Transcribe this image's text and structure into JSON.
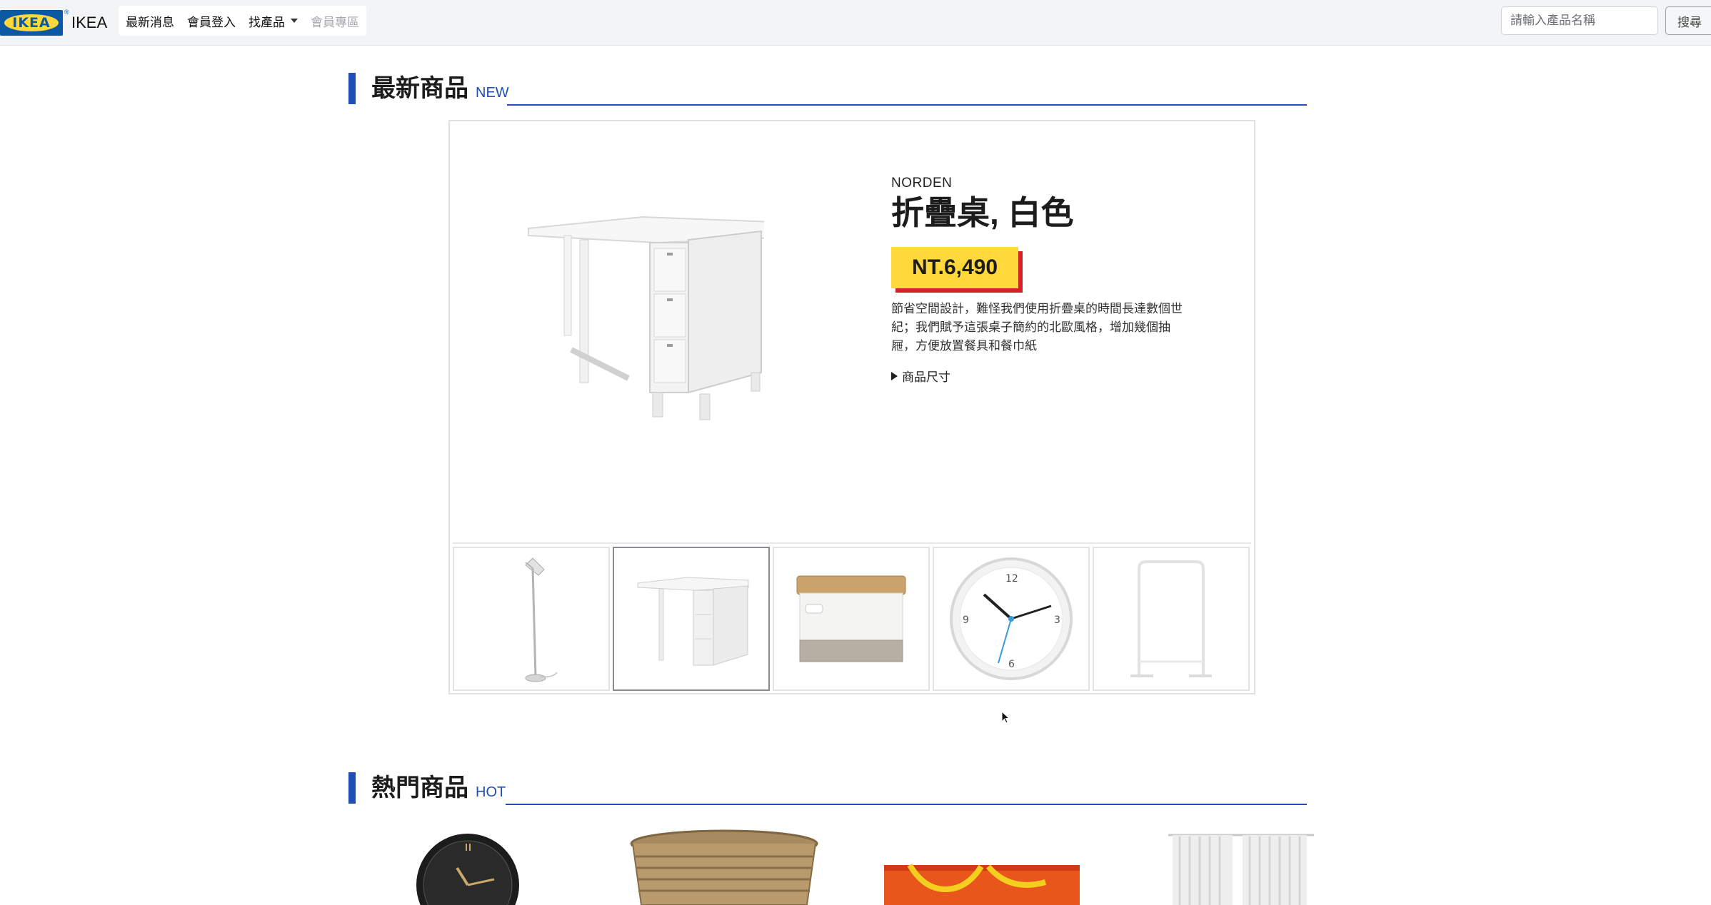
{
  "navbar": {
    "logo_text": "IKEA",
    "logo_reg": "®",
    "brand_name": "IKEA",
    "links": [
      {
        "label": "最新消息"
      },
      {
        "label": "會員登入"
      },
      {
        "label": "找產品"
      },
      {
        "label": "會員專區"
      }
    ],
    "search_placeholder": "請輸入產品名稱",
    "search_button": "搜尋"
  },
  "new_section": {
    "title": "最新商品",
    "subtitle": "NEW"
  },
  "featured": {
    "series": "NORDEN",
    "name": "折疊桌, 白色",
    "price": "NT.6,490",
    "description": "節省空間設計，難怪我們使用折疊桌的時間長達數個世紀；我們賦予這張桌子簡約的北歐風格，增加幾個抽屜，方便放置餐具和餐巾紙",
    "dimensions_label": "商品尺寸"
  },
  "thumbnails": [
    {
      "icon": "floor-lamp-icon",
      "active": false
    },
    {
      "icon": "folding-table-icon",
      "active": true
    },
    {
      "icon": "storage-box-icon",
      "active": false
    },
    {
      "icon": "wall-clock-icon",
      "active": false
    },
    {
      "icon": "clothes-rack-icon",
      "active": false
    }
  ],
  "hot_section": {
    "title": "熱門商品",
    "subtitle": "HOT"
  },
  "hot_items": [
    {
      "icon": "black-clock-icon"
    },
    {
      "icon": "wicker-basket-icon"
    },
    {
      "icon": "shopping-bag-icon"
    },
    {
      "icon": "curtain-icon"
    }
  ],
  "colors": {
    "accent_blue": "#1f4fb5",
    "price_yellow": "#ffd93b",
    "price_red": "#d3222a",
    "ikea_blue": "#0b58a3"
  }
}
